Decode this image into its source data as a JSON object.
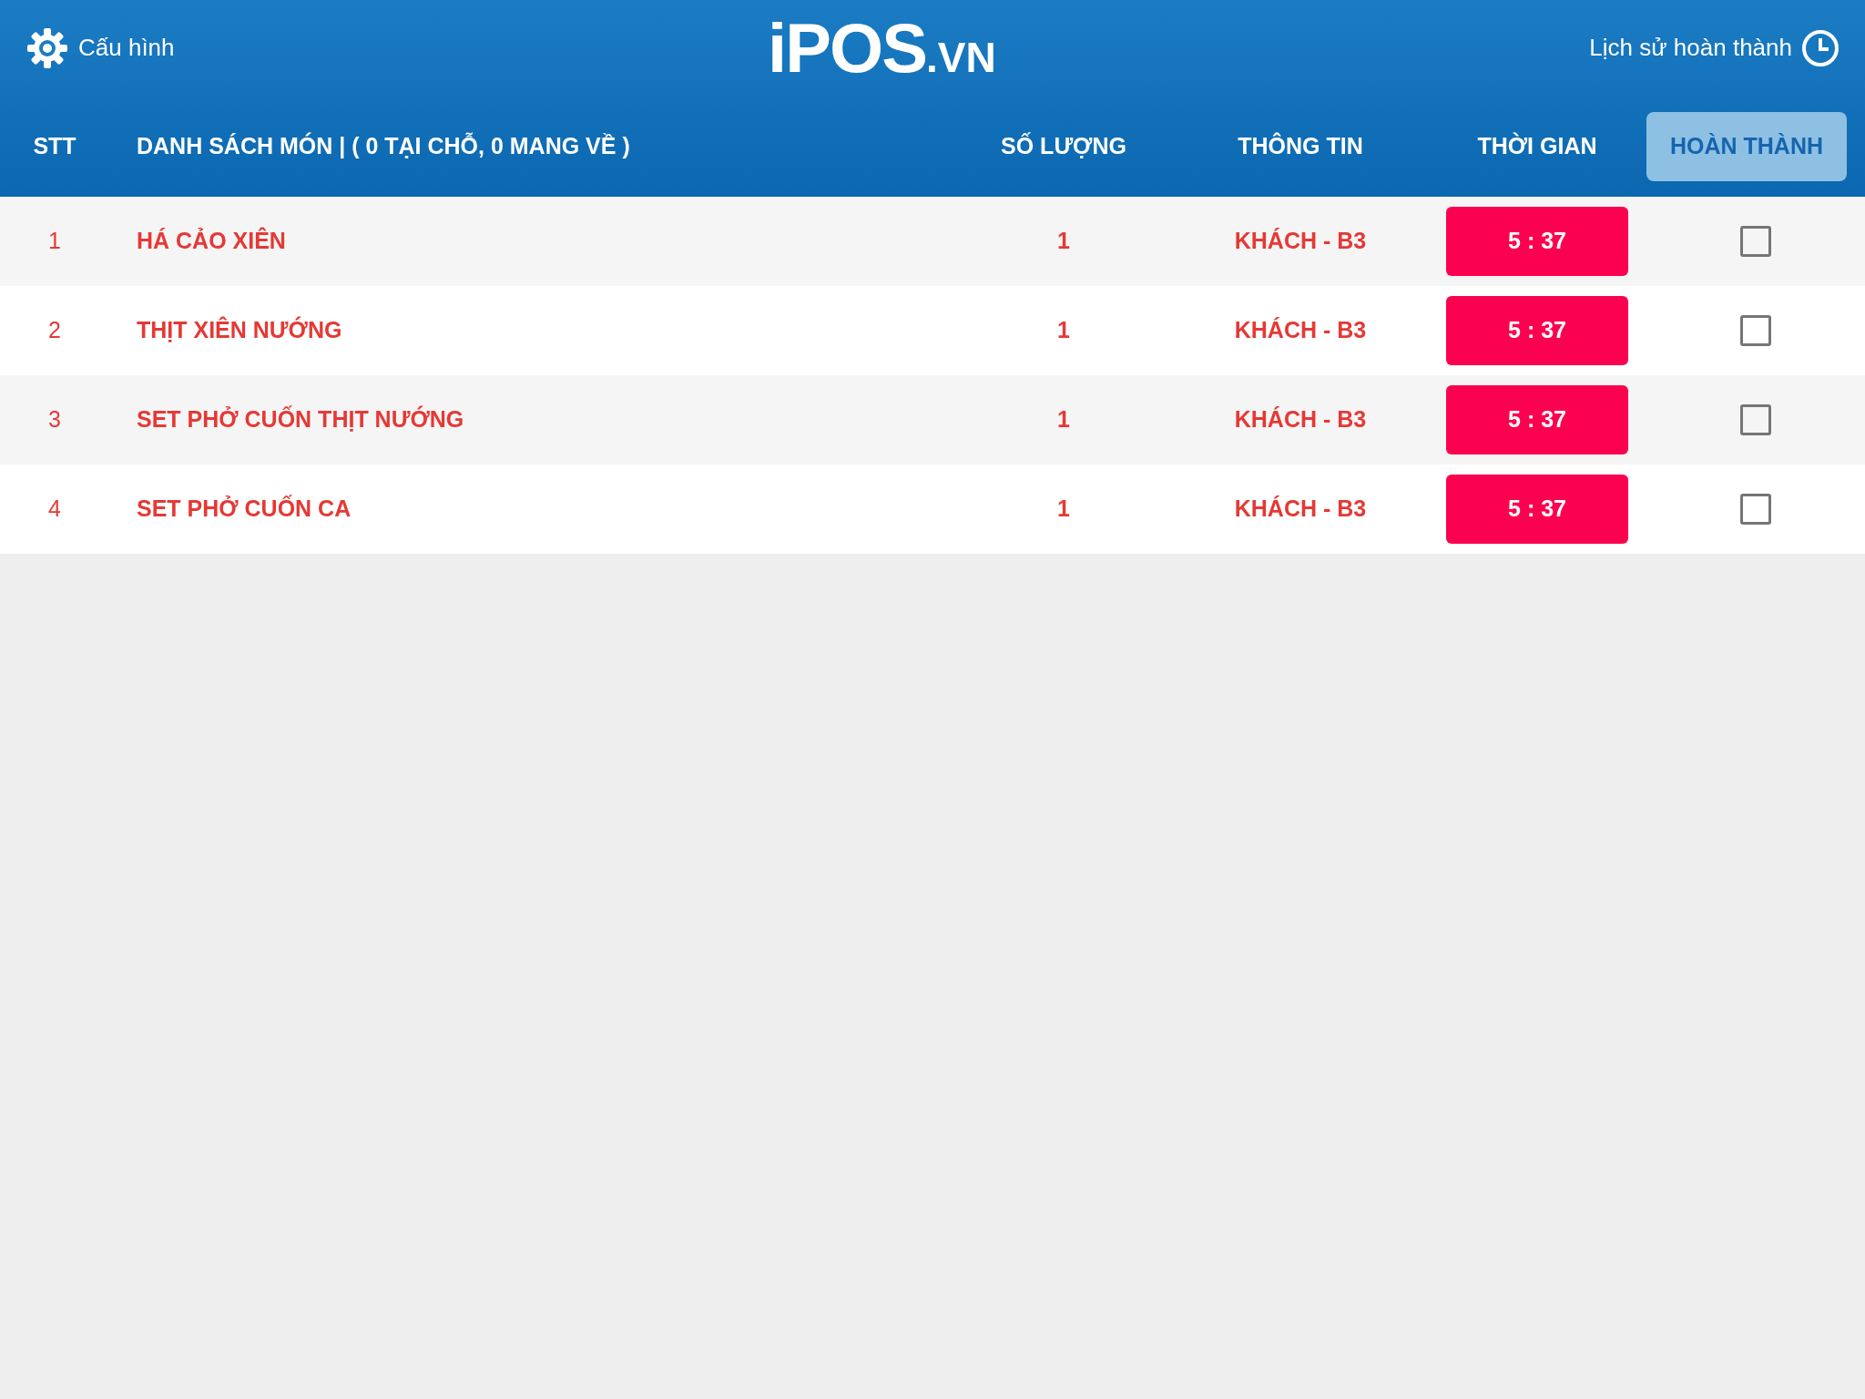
{
  "header": {
    "settings_label": "Cấu hình",
    "logo_main": "iPOS",
    "logo_suffix": ".VN",
    "history_label": "Lịch sử hoàn thành"
  },
  "columns": [
    "STT",
    "DANH SÁCH MÓN | ( 0 TẠI CHỖ, 0 MANG VỀ )",
    "SỐ LƯỢNG",
    "THÔNG TIN",
    "THỜI GIAN"
  ],
  "complete_button": "HOÀN THÀNH",
  "rows": [
    {
      "index": "1",
      "dish": "HÁ CẢO XIÊN",
      "quantity": "1",
      "info": "KHÁCH - B3",
      "time": "5 : 37",
      "checked": false
    },
    {
      "index": "2",
      "dish": "THỊT XIÊN NƯỚNG",
      "quantity": "1",
      "info": "KHÁCH - B3",
      "time": "5 : 37",
      "checked": false
    },
    {
      "index": "3",
      "dish": "SET PHỞ CUỐN THỊT NƯỚNG",
      "quantity": "1",
      "info": "KHÁCH - B3",
      "time": "5 : 37",
      "checked": false
    },
    {
      "index": "4",
      "dish": "SET PHỞ CUỐN CA",
      "quantity": "1",
      "info": "KHÁCH - B3",
      "time": "5 : 37",
      "checked": false
    }
  ]
}
